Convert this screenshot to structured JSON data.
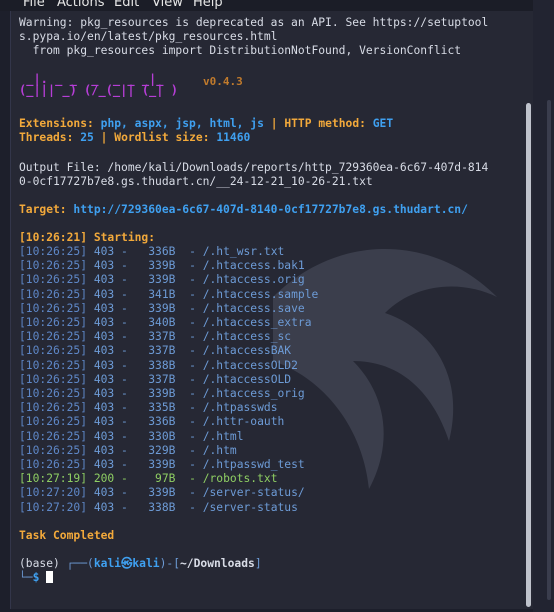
{
  "menu": [
    "File",
    "Actions",
    "Edit",
    "View",
    "Help"
  ],
  "warning": [
    "Warning: pkg_resources is deprecated as an API. See https://setuptool",
    "s.pypa.io/en/latest/pkg_resources.html",
    "  from pkg_resources import DistributionNotFound, VersionConflict"
  ],
  "banner": {
    "art": [
      " _|. _ _  _  _ _ _|_",
      "(_||| _) (/_(_|| (_| )"
    ],
    "version": "v0.4.3"
  },
  "config": {
    "extensions_label": "Extensions:",
    "extensions_value": "php, aspx, jsp, html, js",
    "sep": "|",
    "method_label": "HTTP method:",
    "method_value": "GET",
    "threads_label": "Threads:",
    "threads_value": "25",
    "wordlist_label": "Wordlist size:",
    "wordlist_value": "11460"
  },
  "output": [
    "Output File: /home/kali/Downloads/reports/http_729360ea-6c67-407d-814",
    "0-0cf17727b7e8.gs.thudart.cn/__24-12-21_10-26-21.txt"
  ],
  "target": {
    "label": "Target:",
    "url": "http://729360ea-6c67-407d-8140-0cf17727b7e8.gs.thudart.cn/"
  },
  "start": {
    "time": "[10:26:21]",
    "text": "Starting:"
  },
  "results": [
    {
      "time": "[10:26:25]",
      "status": "403",
      "size": " 336B",
      "path": "/.ht_wsr.txt",
      "ok": false
    },
    {
      "time": "[10:26:25]",
      "status": "403",
      "size": " 339B",
      "path": "/.htaccess.bak1",
      "ok": false
    },
    {
      "time": "[10:26:25]",
      "status": "403",
      "size": " 339B",
      "path": "/.htaccess.orig",
      "ok": false
    },
    {
      "time": "[10:26:25]",
      "status": "403",
      "size": " 341B",
      "path": "/.htaccess.sample",
      "ok": false
    },
    {
      "time": "[10:26:25]",
      "status": "403",
      "size": " 339B",
      "path": "/.htaccess.save",
      "ok": false
    },
    {
      "time": "[10:26:25]",
      "status": "403",
      "size": " 340B",
      "path": "/.htaccess_extra",
      "ok": false
    },
    {
      "time": "[10:26:25]",
      "status": "403",
      "size": " 337B",
      "path": "/.htaccess_sc",
      "ok": false
    },
    {
      "time": "[10:26:25]",
      "status": "403",
      "size": " 337B",
      "path": "/.htaccessBAK",
      "ok": false
    },
    {
      "time": "[10:26:25]",
      "status": "403",
      "size": " 338B",
      "path": "/.htaccessOLD2",
      "ok": false
    },
    {
      "time": "[10:26:25]",
      "status": "403",
      "size": " 337B",
      "path": "/.htaccessOLD",
      "ok": false
    },
    {
      "time": "[10:26:25]",
      "status": "403",
      "size": " 339B",
      "path": "/.htaccess_orig",
      "ok": false
    },
    {
      "time": "[10:26:25]",
      "status": "403",
      "size": " 335B",
      "path": "/.htpasswds",
      "ok": false
    },
    {
      "time": "[10:26:25]",
      "status": "403",
      "size": " 336B",
      "path": "/.httr-oauth",
      "ok": false
    },
    {
      "time": "[10:26:25]",
      "status": "403",
      "size": " 330B",
      "path": "/.html",
      "ok": false
    },
    {
      "time": "[10:26:25]",
      "status": "403",
      "size": " 329B",
      "path": "/.htm",
      "ok": false
    },
    {
      "time": "[10:26:25]",
      "status": "403",
      "size": " 339B",
      "path": "/.htpasswd_test",
      "ok": false
    },
    {
      "time": "[10:27:19]",
      "status": "200",
      "size": "  97B",
      "path": "/robots.txt",
      "ok": true
    },
    {
      "time": "[10:27:20]",
      "status": "403",
      "size": " 339B",
      "path": "/server-status/",
      "ok": false
    },
    {
      "time": "[10:27:20]",
      "status": "403",
      "size": " 338B",
      "path": "/server-status",
      "ok": false
    }
  ],
  "task_completed": "Task Completed",
  "prompt": {
    "env": "(base)",
    "user": "kali",
    "at": "㉿",
    "host": "kali",
    "dir": "~/Downloads",
    "symbol": "$"
  },
  "colors": {
    "accent": "#f2a93b",
    "info": "#3fa0f0",
    "ok": "#8fcf63",
    "path": "#6d9bd6"
  }
}
